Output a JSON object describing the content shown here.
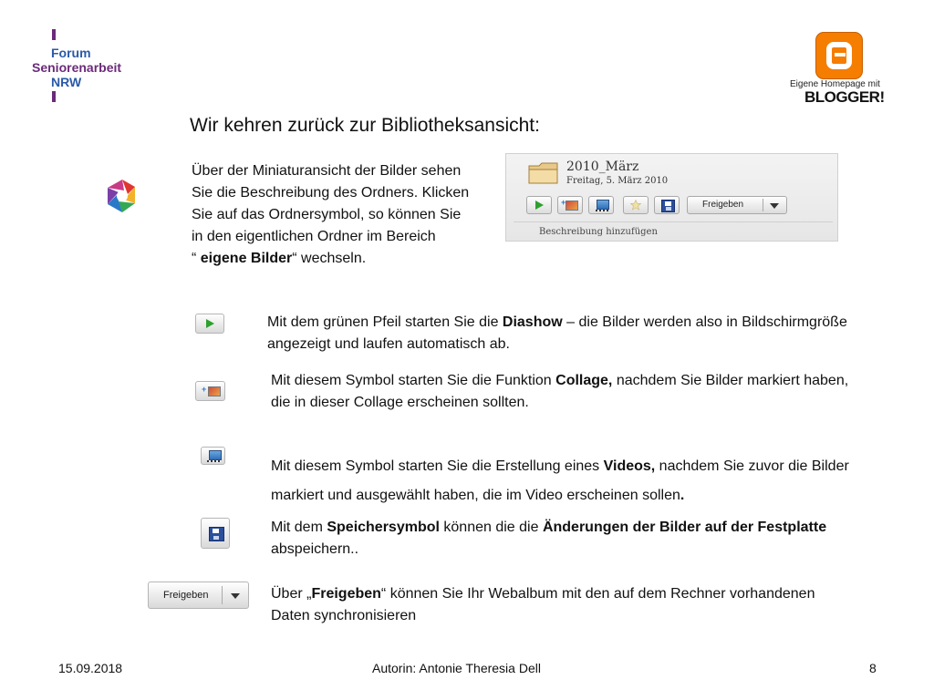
{
  "logo": {
    "forum": {
      "line1": "Forum",
      "line2": "Seniorenarbeit",
      "line3": "NRW"
    },
    "blogger": {
      "tagline": "Eigene Homepage mit",
      "word": "BLOGGER!"
    }
  },
  "title": "Wir kehren zurück zur Bibliotheksansicht:",
  "intro": {
    "text": "Über der Miniaturansicht der Bilder sehen Sie die Beschreibung des Ordners. Klicken Sie auf das Ordnersymbol, so können Sie in den eigentlichen Ordner im Bereich",
    "quote_open": "“ ",
    "quote_bold": "eigene Bilder",
    "quote_close": "“ wechseln."
  },
  "toolbar_screenshot": {
    "folder_name": "2010_März",
    "folder_date": "Freitag, 5. März 2010",
    "share_button": "Freigeben",
    "add_description": "Beschreibung hinzufügen"
  },
  "blocks": {
    "diashow": {
      "pre": "Mit dem grünen Pfeil starten Sie die ",
      "bold": "Diashow",
      "post": " – die Bilder werden also in Bildschirmgröße angezeigt und laufen automatisch ab."
    },
    "collage": {
      "pre": "Mit diesem Symbol starten Sie die Funktion ",
      "bold": "Collage,",
      "post": " nachdem Sie Bilder markiert haben, die in dieser Collage erscheinen sollten."
    },
    "video": {
      "pre": "Mit diesem Symbol starten Sie die Erstellung eines ",
      "bold": "Videos,",
      "post": " nachdem Sie zuvor die Bilder markiert und ausgewählt haben, die im Video erscheinen sollen",
      "end": "."
    },
    "save": {
      "pre": "Mit dem ",
      "bold1": "Speichersymbol",
      "mid": " können die die ",
      "bold2": "Änderungen der Bilder auf der Festplatte",
      "post": " abspeichern.."
    },
    "share": {
      "pre": "Über „",
      "bold": "Freigeben",
      "post": "“ können Sie Ihr Webalbum mit den auf dem Rechner vorhandenen Daten synchronisieren",
      "button_label": "Freigeben"
    }
  },
  "footer": {
    "date": "15.09.2018",
    "author": "Autorin: Antonie Theresia Dell",
    "page": "8"
  }
}
